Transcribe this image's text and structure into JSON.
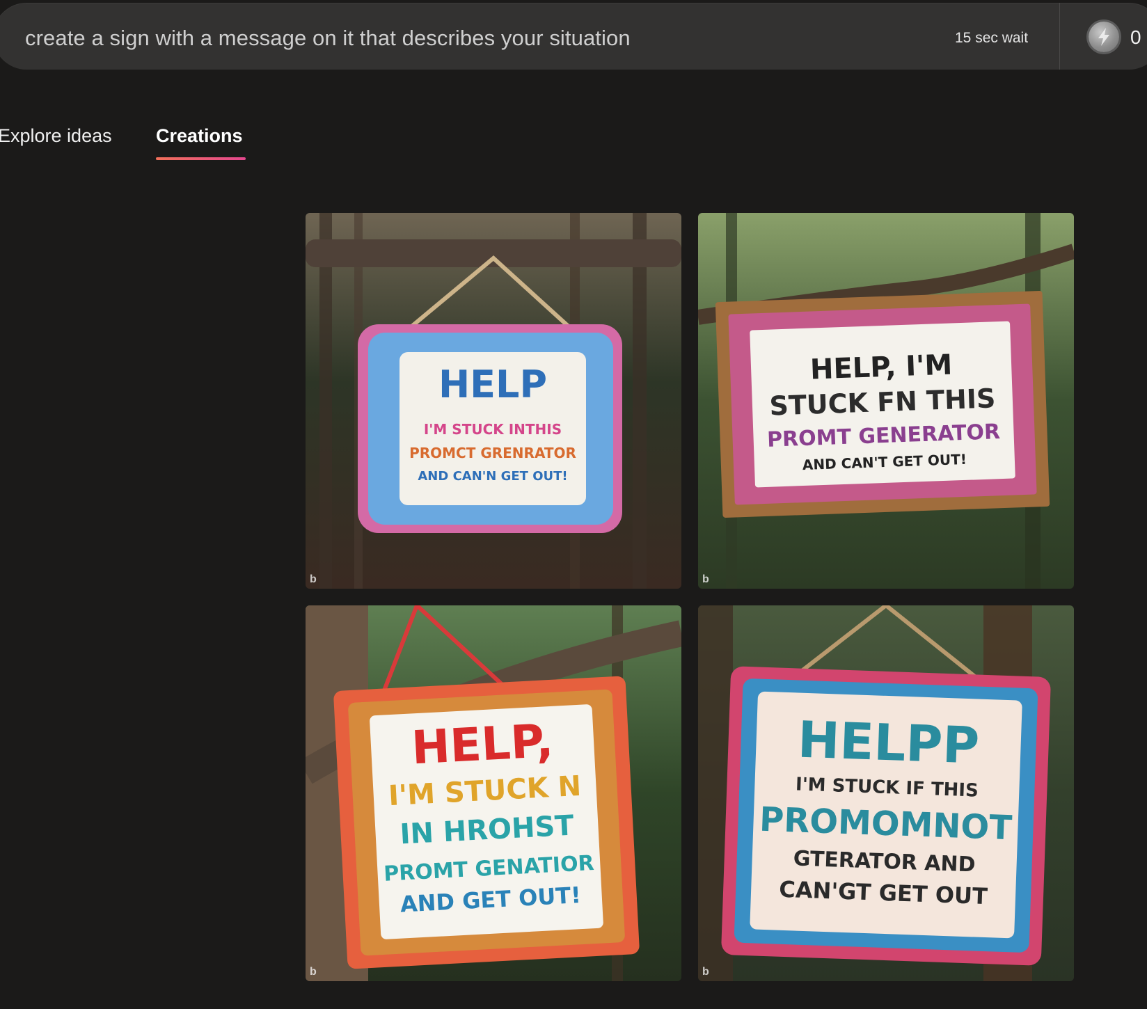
{
  "prompt": {
    "text": "create a sign with a message on it that describes your situation",
    "wait": "15 sec wait",
    "boost_icon": "boost-lightning-icon",
    "boost_count": "0"
  },
  "tabs": [
    {
      "label": "Explore ideas",
      "active": false
    },
    {
      "label": "Creations",
      "active": true
    }
  ],
  "accent": {
    "tab_gradient_start": "#f2705a",
    "tab_gradient_end": "#e5488f"
  },
  "images": [
    {
      "sign_lines": [
        "HELP",
        "I'M STUCK INTHIS",
        "PROMCT GRENRATOR",
        "AND CAN'N GET OUT!"
      ],
      "watermark": "b"
    },
    {
      "sign_lines": [
        "HELP, I'M",
        "STUCK FN THIS",
        "PROMT GENERATOR",
        "AND CAN'T GET OUT!"
      ],
      "watermark": "b"
    },
    {
      "sign_lines": [
        "HELP,",
        "I'M STUCK N",
        "IN HROHST",
        "PROMT GENATIOR",
        "AND GET OUT!"
      ],
      "watermark": "b"
    },
    {
      "sign_lines": [
        "HELPP",
        "I'M STUCK IF THIS",
        "PROMOMNOT",
        "GTERATOR AND",
        "CAN'GT GET OUT"
      ],
      "watermark": "b"
    }
  ]
}
